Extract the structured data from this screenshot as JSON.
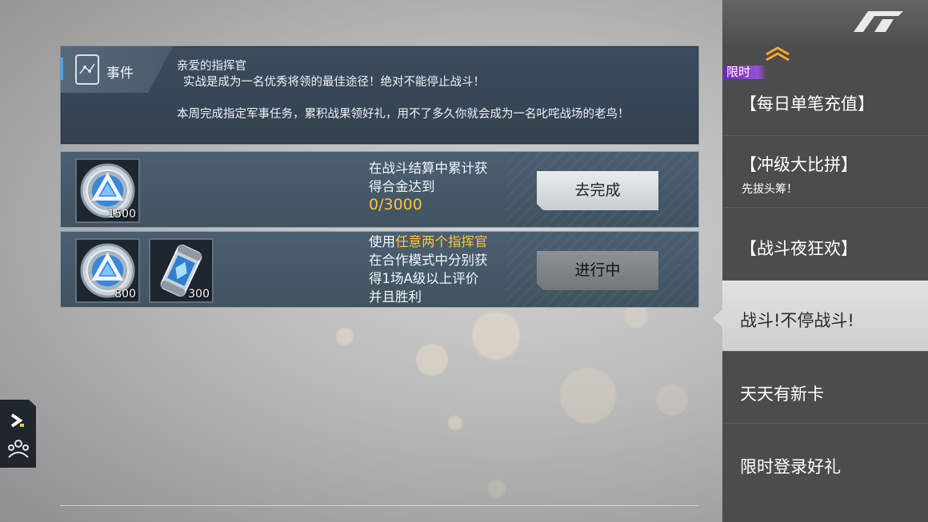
{
  "event": {
    "tag_label": "事件",
    "greeting": "亲爱的指挥官",
    "line1": "实战是成为一名优秀将领的最佳途径！绝对不能停止战斗！",
    "line2": "本周完成指定军事任务，累积战果领好礼，用不了多久你就会成为一名叱咤战场的老鸟！"
  },
  "tasks": [
    {
      "rewards": [
        {
          "icon": "alloy-coin-icon",
          "count": "1500"
        }
      ],
      "desc_lines": [
        "在战斗结算中累计获",
        "得合金达到"
      ],
      "progress": "0/3000",
      "button": "去完成"
    },
    {
      "rewards": [
        {
          "icon": "alloy-coin-icon",
          "count": "800"
        },
        {
          "icon": "energy-canister-icon",
          "count": "300"
        }
      ],
      "desc_prefix": "使用",
      "desc_highlight": "任意两个指挥官",
      "desc_lines": [
        "在合作模式中分别获",
        "得1场A级以上评价",
        "并且胜利"
      ],
      "button": "进行中"
    }
  ],
  "menu": {
    "badge": "限时",
    "items": [
      {
        "label": "【每日单笔充值】",
        "sub": ""
      },
      {
        "label": "【冲级大比拼】",
        "sub": "先拔头筹！"
      },
      {
        "label": "【战斗夜狂欢】",
        "sub": ""
      },
      {
        "label": "战斗!不停战斗!",
        "sub": "",
        "selected": true
      },
      {
        "label": "天天有新卡",
        "sub": ""
      },
      {
        "label": "限时登录好礼",
        "sub": ""
      }
    ]
  },
  "colors": {
    "highlight": "#ffc533",
    "selected_bg": "#dcdcdc",
    "panel": "#3d4c5c",
    "badge": "#7a33c0"
  }
}
